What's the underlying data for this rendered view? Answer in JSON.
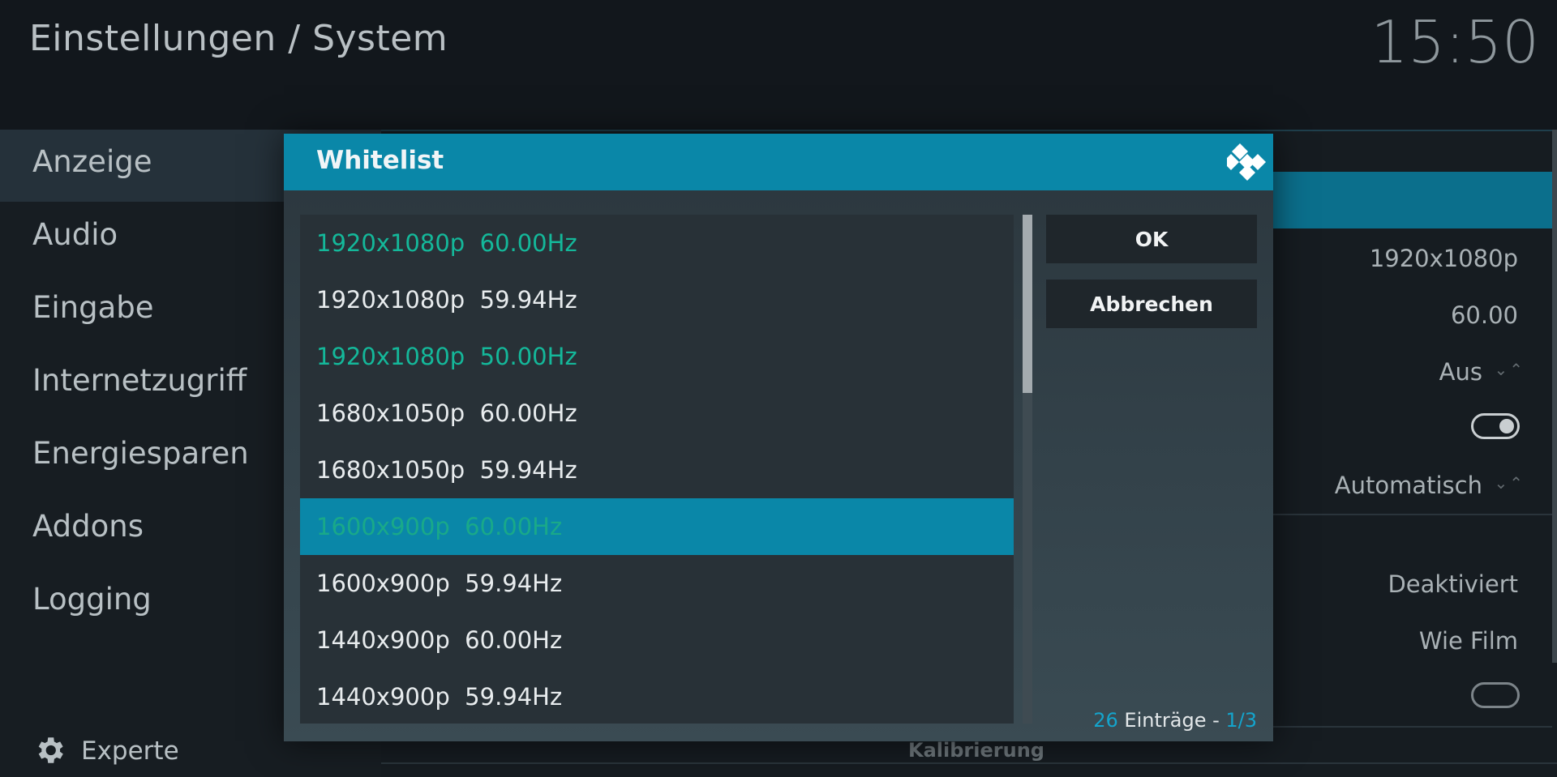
{
  "header": {
    "title": "Einstellungen / System",
    "clock": "15:50"
  },
  "sidebar": {
    "items": [
      {
        "label": "Anzeige",
        "active": true
      },
      {
        "label": "Audio"
      },
      {
        "label": "Eingabe"
      },
      {
        "label": "Internetzugriff"
      },
      {
        "label": "Energiesparen"
      },
      {
        "label": "Addons"
      },
      {
        "label": "Logging"
      }
    ],
    "footer": {
      "icon": "gear-icon",
      "label": "Experte"
    }
  },
  "background_settings": {
    "values": [
      "1920x1080p",
      "60.00",
      "Aus",
      "Automatisch",
      "Deaktiviert",
      "Wie Film"
    ],
    "toggles": [
      true,
      false
    ],
    "bottom_label": "Kalibrierung"
  },
  "dialog": {
    "title": "Whitelist",
    "items": [
      {
        "label": "1920x1080p  60.00Hz",
        "checked": true
      },
      {
        "label": "1920x1080p  59.94Hz",
        "checked": false
      },
      {
        "label": "1920x1080p  50.00Hz",
        "checked": true
      },
      {
        "label": "1680x1050p  60.00Hz",
        "checked": false
      },
      {
        "label": "1680x1050p  59.94Hz",
        "checked": false
      },
      {
        "label": "1600x900p  60.00Hz",
        "checked": true,
        "focused": true
      },
      {
        "label": "1600x900p  59.94Hz",
        "checked": false
      },
      {
        "label": "1440x900p  60.00Hz",
        "checked": false
      },
      {
        "label": "1440x900p  59.94Hz",
        "checked": false
      }
    ],
    "buttons": {
      "ok": "OK",
      "cancel": "Abbrechen"
    },
    "count": {
      "total": "26",
      "text": " Einträge - ",
      "page": "1/3"
    }
  },
  "colors": {
    "accent": "#0a87a8",
    "checked": "#14b89a",
    "count_accent": "#14a4cc"
  }
}
